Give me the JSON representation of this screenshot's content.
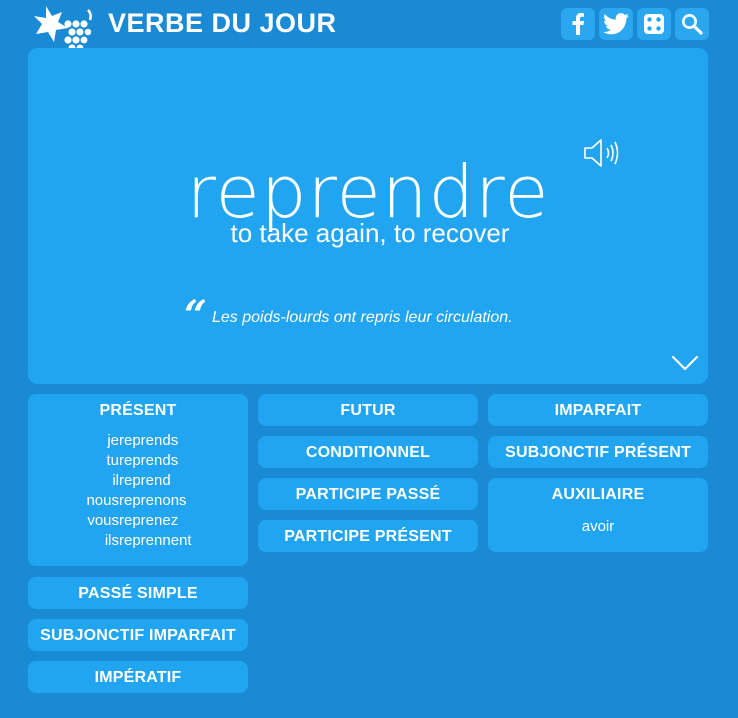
{
  "header": {
    "site_title": "VERBE DU JOUR",
    "logo_icon": "grape-flower-logo",
    "actions": [
      {
        "name": "facebook",
        "icon": "facebook-icon"
      },
      {
        "name": "twitter",
        "icon": "twitter-icon"
      },
      {
        "name": "random",
        "icon": "dice-icon"
      },
      {
        "name": "search",
        "icon": "search-icon"
      }
    ]
  },
  "hero": {
    "verb": "reprendre",
    "translation": "to take again, to recover",
    "quote_mark": "“",
    "example": "Les poids-lourds ont repris leur circulation."
  },
  "tenses": {
    "present": {
      "title": "PRÉSENT",
      "rows": [
        {
          "pronoun": "je",
          "form": "reprends"
        },
        {
          "pronoun": "tu",
          "form": "reprends"
        },
        {
          "pronoun": "il",
          "form": "reprend"
        },
        {
          "pronoun": "nous",
          "form": "reprenons"
        },
        {
          "pronoun": "vous",
          "form": "reprenez"
        },
        {
          "pronoun": "ils",
          "form": "reprennent"
        }
      ]
    },
    "futur": "FUTUR",
    "imparfait": "IMPARFAIT",
    "conditionnel": "CONDITIONNEL",
    "subjonctif_present": "SUBJONCTIF PRÉSENT",
    "participe_passe": "PARTICIPE PASSÉ",
    "auxiliaire": {
      "title": "AUXILIAIRE",
      "value": "avoir"
    },
    "participe_present": "PARTICIPE PRÉSENT",
    "passe_simple": "PASSÉ SIMPLE",
    "subjonctif_imparfait": "SUBJONCTIF IMPARFAIT",
    "imperatif": "IMPÉRATIF"
  },
  "colors": {
    "background": "#1a8ad4",
    "panel": "#21a5f0",
    "text": "#ffffff"
  }
}
